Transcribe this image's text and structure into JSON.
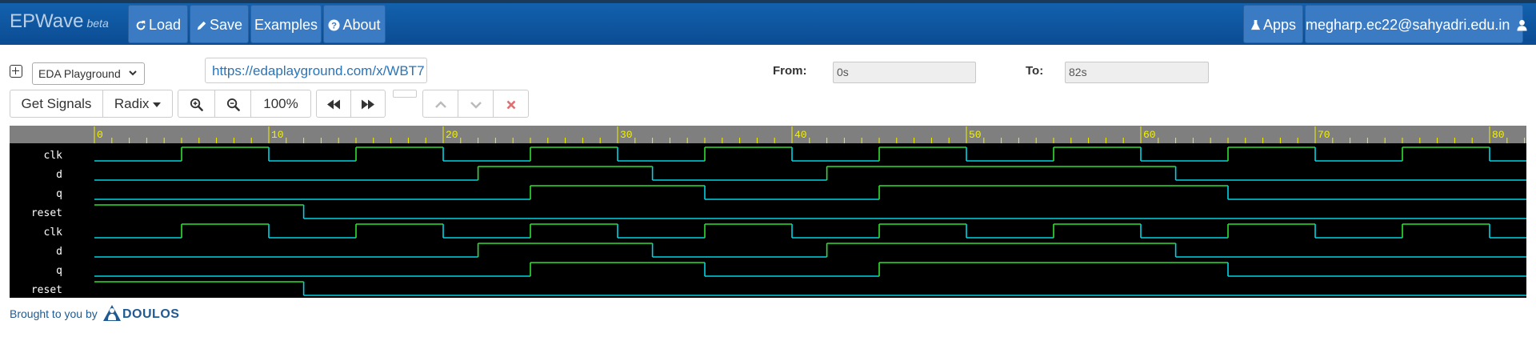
{
  "navbar": {
    "brand": "EPWave",
    "brand_beta": "beta",
    "load_label": "Load",
    "save_label": "Save",
    "examples_label": "Examples",
    "about_label": "About",
    "apps_label": "Apps",
    "user_label": "megharp.ec22@sahyadri.edu.in"
  },
  "toolbar": {
    "source_select": "EDA Playground",
    "url": "https://edaplayground.com/x/WBT7",
    "from_label": "From:",
    "from_value": "0s",
    "to_label": "To:",
    "to_value": "82s",
    "get_signals_label": "Get Signals",
    "radix_label": "Radix",
    "zoom_level": "100%"
  },
  "waveform": {
    "time_start": 0,
    "time_end": 82,
    "tick_labels": [
      "0",
      "10",
      "20",
      "30",
      "40",
      "50",
      "60",
      "70",
      "80"
    ],
    "signals": [
      {
        "name": "clk",
        "initial": 0,
        "transitions": [
          5,
          10,
          15,
          20,
          25,
          30,
          35,
          40,
          45,
          50,
          55,
          60,
          65,
          70,
          75,
          80
        ]
      },
      {
        "name": "d",
        "initial": 0,
        "transitions": [
          22,
          32,
          42,
          62
        ]
      },
      {
        "name": "q",
        "initial": 0,
        "transitions": [
          25,
          35,
          45,
          65
        ]
      },
      {
        "name": "reset",
        "initial": 1,
        "transitions": [
          12
        ]
      },
      {
        "name": "clk",
        "initial": 0,
        "transitions": [
          5,
          10,
          15,
          20,
          25,
          30,
          35,
          40,
          45,
          50,
          55,
          60,
          65,
          70,
          75,
          80
        ]
      },
      {
        "name": "d",
        "initial": 0,
        "transitions": [
          22,
          32,
          42,
          62
        ]
      },
      {
        "name": "q",
        "initial": 0,
        "transitions": [
          25,
          35,
          45,
          65
        ]
      },
      {
        "name": "reset",
        "initial": 1,
        "transitions": [
          12
        ]
      }
    ],
    "colors": {
      "background": "#000000",
      "ruler": "#7f7f7f",
      "tick": "#f2f200",
      "high": "#30e030",
      "low": "#00d4e4",
      "label": "#ffffff"
    }
  },
  "footer": {
    "brought_by": "Brought to you by",
    "company": "DOULOS"
  }
}
